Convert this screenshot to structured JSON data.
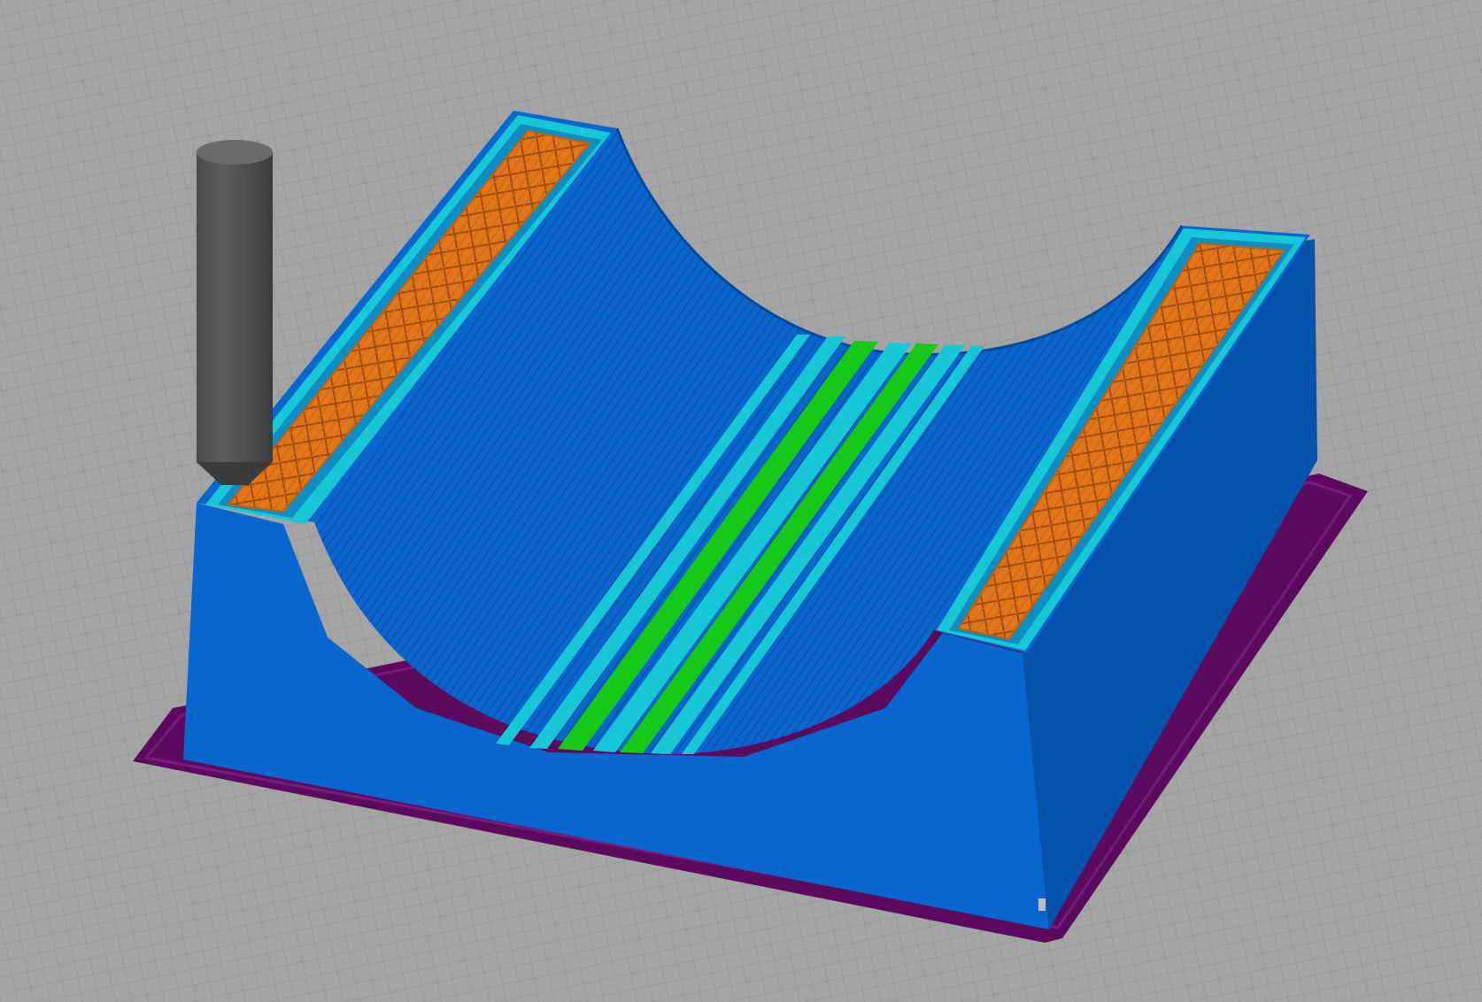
{
  "viewer": {
    "mode": "sliced-preview"
  },
  "model": {
    "shape": "cradle",
    "feature_colors": {
      "bed": "#a4a4a4",
      "bed_grid": "#8f8f8f",
      "skirt": "#5b0a5e",
      "perimeter": "#0866cf",
      "perimeter_shade": "#0550a8",
      "external_perimeter": "#17c7d6",
      "infill": "#e1761a",
      "infill_line": "#9e4a0b",
      "top_solid": "#16c916",
      "nozzle": "#555555"
    }
  },
  "tool": {
    "icon": "nozzle-icon"
  }
}
